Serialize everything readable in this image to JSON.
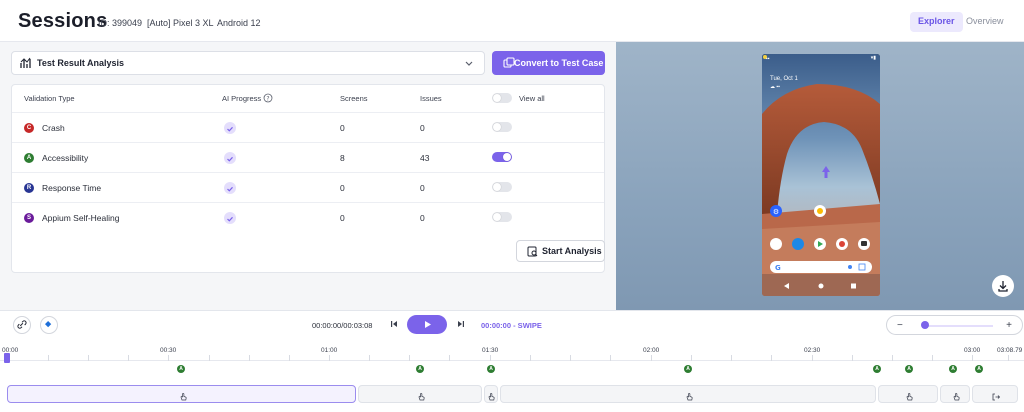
{
  "header": {
    "title": "Sessions",
    "id_label": "ID: 399049",
    "device": "[Auto] Pixel 3 XL",
    "os": "Android 12",
    "tabs": [
      {
        "label": "Explorer",
        "active": true
      },
      {
        "label": "Overview",
        "active": false
      }
    ]
  },
  "analysis": {
    "dropdown_value": "Test Result Analysis",
    "convert_button": "Convert to Test Case",
    "start_button": "Start Analysis"
  },
  "table": {
    "headers": [
      "Validation Type",
      "AI Progress",
      "Screens",
      "Issues",
      "View all"
    ],
    "rows": [
      {
        "badge": "C",
        "badge_color": "#c62828",
        "type": "Crash",
        "screens": "0",
        "issues": "0",
        "view": false
      },
      {
        "badge": "A",
        "badge_color": "#2e7d32",
        "type": "Accessibility",
        "screens": "8",
        "issues": "43",
        "view": true
      },
      {
        "badge": "R",
        "badge_color": "#283593",
        "type": "Response Time",
        "screens": "0",
        "issues": "0",
        "view": false
      },
      {
        "badge": "S",
        "badge_color": "#6a1b9a",
        "type": "Appium Self-Healing",
        "screens": "0",
        "issues": "0",
        "view": false
      }
    ]
  },
  "device": {
    "date": "Tue, Oct 1"
  },
  "player": {
    "time": "00:00:00/00:03:08",
    "action": "00:00:00 - SWIPE",
    "zoom_level": 0.05
  },
  "timeline": {
    "ticks": [
      {
        "label": "00:00"
      },
      {
        "label": "00:30"
      },
      {
        "label": "01:00"
      },
      {
        "label": "01:30"
      },
      {
        "label": "02:00"
      },
      {
        "label": "02:30"
      },
      {
        "label": "03:00"
      },
      {
        "label": "03:08.79"
      }
    ],
    "marker_label": "A"
  },
  "colors": {
    "accent": "#7b63ea",
    "accent_light": "#ece9fd"
  }
}
